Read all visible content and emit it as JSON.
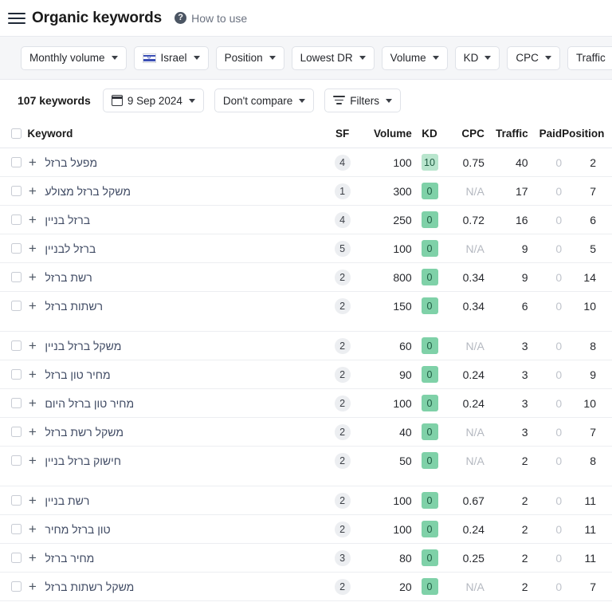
{
  "header": {
    "menu_icon": "hamburger-icon",
    "title": "Organic keywords",
    "help_icon": "question-mark-icon",
    "help_label": "How to use"
  },
  "filter_bar": {
    "chips": [
      {
        "label": "Monthly volume",
        "icon": null
      },
      {
        "label": "Israel",
        "icon": "israel-flag-icon"
      },
      {
        "label": "Position",
        "icon": null
      },
      {
        "label": "Lowest DR",
        "icon": null
      },
      {
        "label": "Volume",
        "icon": null
      },
      {
        "label": "KD",
        "icon": null
      },
      {
        "label": "CPC",
        "icon": null
      },
      {
        "label": "Traffic",
        "icon": null
      }
    ]
  },
  "toolbar": {
    "keyword_count": "107 keywords",
    "date_icon": "calendar-icon",
    "date_label": "9 Sep 2024",
    "compare_label": "Don't compare",
    "filters_icon": "filters-icon",
    "filters_label": "Filters"
  },
  "table": {
    "columns": [
      "Keyword",
      "SF",
      "Volume",
      "KD",
      "CPC",
      "Traffic",
      "Paid",
      "Position"
    ],
    "rows": [
      {
        "keyword": "מפעל ברזל",
        "sf": "4",
        "volume": "100",
        "kd": "10",
        "cpc": "0.75",
        "traffic": "40",
        "paid": "0",
        "position": "2"
      },
      {
        "keyword": "משקל ברזל מצולע",
        "sf": "1",
        "volume": "300",
        "kd": "0",
        "cpc": "N/A",
        "traffic": "17",
        "paid": "0",
        "position": "7"
      },
      {
        "keyword": "ברזל בניין",
        "sf": "4",
        "volume": "250",
        "kd": "0",
        "cpc": "0.72",
        "traffic": "16",
        "paid": "0",
        "position": "6"
      },
      {
        "keyword": "ברזל לבניין",
        "sf": "5",
        "volume": "100",
        "kd": "0",
        "cpc": "N/A",
        "traffic": "9",
        "paid": "0",
        "position": "5"
      },
      {
        "keyword": "רשת ברזל",
        "sf": "2",
        "volume": "800",
        "kd": "0",
        "cpc": "0.34",
        "traffic": "9",
        "paid": "0",
        "position": "14"
      },
      {
        "keyword": "רשתות ברזל",
        "sf": "2",
        "volume": "150",
        "kd": "0",
        "cpc": "0.34",
        "traffic": "6",
        "paid": "0",
        "position": "10"
      },
      {
        "keyword": "משקל ברזל בניין",
        "sf": "2",
        "volume": "60",
        "kd": "0",
        "cpc": "N/A",
        "traffic": "3",
        "paid": "0",
        "position": "8"
      },
      {
        "keyword": "מחיר טון ברזל",
        "sf": "2",
        "volume": "90",
        "kd": "0",
        "cpc": "0.24",
        "traffic": "3",
        "paid": "0",
        "position": "9"
      },
      {
        "keyword": "מחיר טון ברזל היום",
        "sf": "2",
        "volume": "100",
        "kd": "0",
        "cpc": "0.24",
        "traffic": "3",
        "paid": "0",
        "position": "10"
      },
      {
        "keyword": "משקל רשת ברזל",
        "sf": "2",
        "volume": "40",
        "kd": "0",
        "cpc": "N/A",
        "traffic": "3",
        "paid": "0",
        "position": "7"
      },
      {
        "keyword": "חישוק ברזל בניין",
        "sf": "2",
        "volume": "50",
        "kd": "0",
        "cpc": "N/A",
        "traffic": "2",
        "paid": "0",
        "position": "8"
      },
      {
        "keyword": "רשת בניין",
        "sf": "2",
        "volume": "100",
        "kd": "0",
        "cpc": "0.67",
        "traffic": "2",
        "paid": "0",
        "position": "11"
      },
      {
        "keyword": "טון ברזל מחיר",
        "sf": "2",
        "volume": "100",
        "kd": "0",
        "cpc": "0.24",
        "traffic": "2",
        "paid": "0",
        "position": "11"
      },
      {
        "keyword": "מחיר ברזל",
        "sf": "3",
        "volume": "80",
        "kd": "0",
        "cpc": "0.25",
        "traffic": "2",
        "paid": "0",
        "position": "11"
      },
      {
        "keyword": "משקל רשתות ברזל",
        "sf": "2",
        "volume": "20",
        "kd": "0",
        "cpc": "N/A",
        "traffic": "2",
        "paid": "0",
        "position": "7"
      }
    ],
    "group_breaks_after": [
      5,
      10
    ]
  },
  "colors": {
    "kd_low": "#7fd1a8",
    "kd_mid": "#b8e5cd",
    "sf_badge": "#eceef1",
    "filter_bar_bg": "#f5f6f8",
    "link": "#3f4a63"
  }
}
